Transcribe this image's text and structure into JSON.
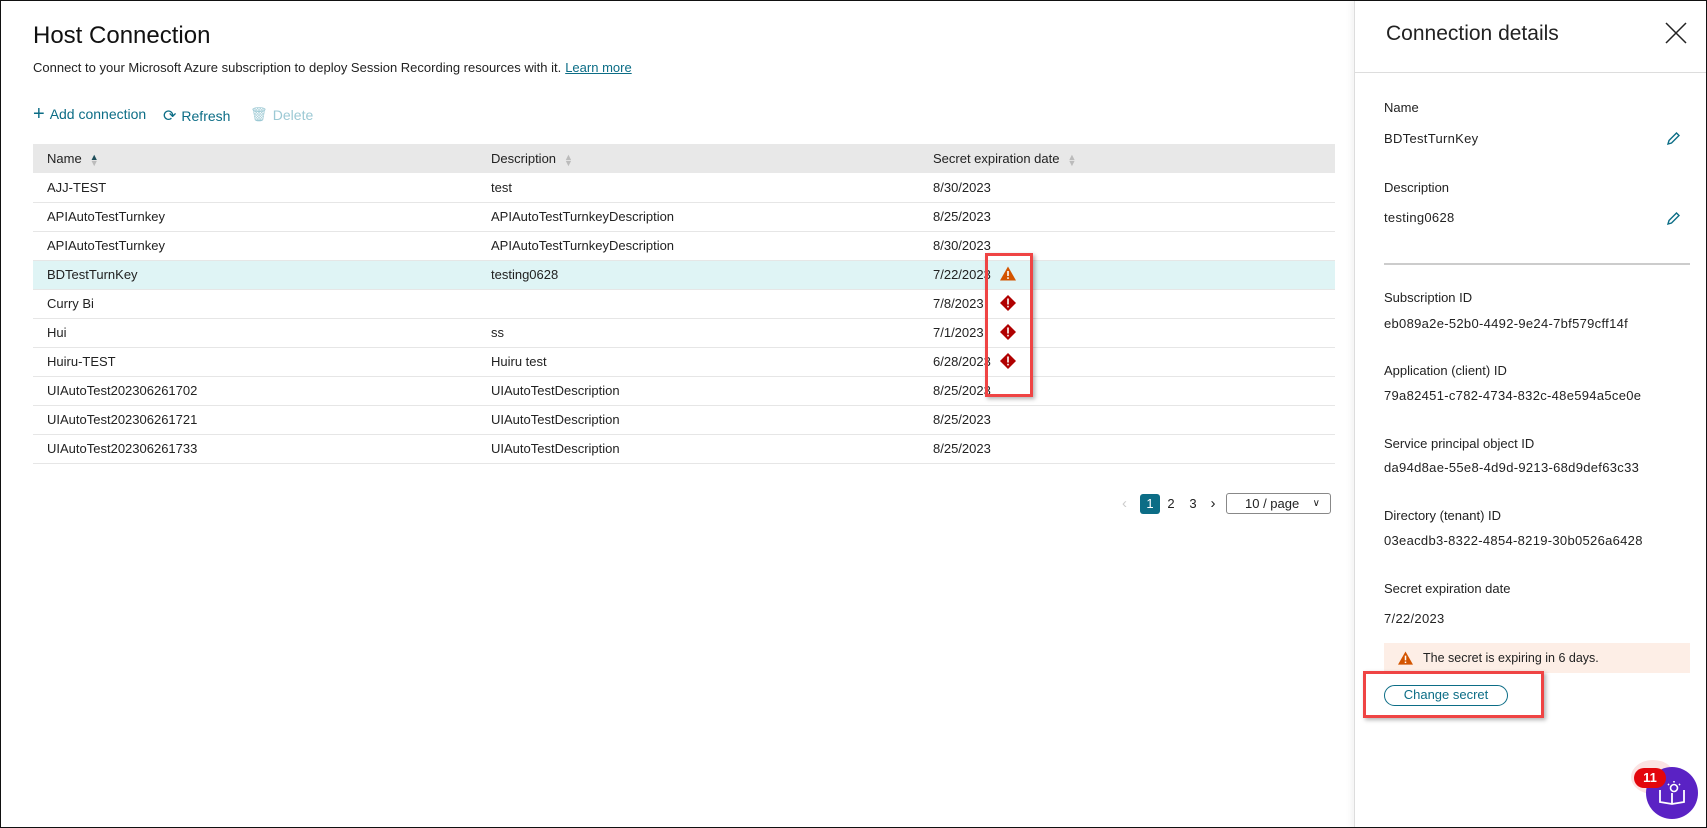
{
  "header": {
    "title": "Host Connection",
    "subtitle": "Connect to your Microsoft Azure subscription to deploy Session Recording resources with it.",
    "learn_more": "Learn more"
  },
  "toolbar": {
    "add": "Add connection",
    "refresh": "Refresh",
    "delete": "Delete"
  },
  "table": {
    "columns": [
      "Name",
      "Description",
      "Secret expiration date"
    ],
    "rows": [
      {
        "name": "AJJ-TEST",
        "description": "test",
        "expiry": "8/30/2023",
        "status": ""
      },
      {
        "name": "APIAutoTestTurnkey",
        "description": "APIAutoTestTurnkeyDescription",
        "expiry": "8/25/2023",
        "status": ""
      },
      {
        "name": "APIAutoTestTurnkey",
        "description": "APIAutoTestTurnkeyDescription",
        "expiry": "8/30/2023",
        "status": ""
      },
      {
        "name": "BDTestTurnKey",
        "description": "testing0628",
        "expiry": "7/22/2023",
        "status": "warning"
      },
      {
        "name": "Curry Bi",
        "description": "",
        "expiry": "7/8/2023",
        "status": "expired"
      },
      {
        "name": "Hui",
        "description": "ss",
        "expiry": "7/1/2023",
        "status": "expired"
      },
      {
        "name": "Huiru-TEST",
        "description": "Huiru test",
        "expiry": "6/28/2023",
        "status": "expired"
      },
      {
        "name": "UIAutoTest202306261702",
        "description": "UIAutoTestDescription",
        "expiry": "8/25/2023",
        "status": ""
      },
      {
        "name": "UIAutoTest202306261721",
        "description": "UIAutoTestDescription",
        "expiry": "8/25/2023",
        "status": ""
      },
      {
        "name": "UIAutoTest202306261733",
        "description": "UIAutoTestDescription",
        "expiry": "8/25/2023",
        "status": ""
      }
    ]
  },
  "pagination": {
    "pages": [
      "1",
      "2",
      "3"
    ],
    "current": "1",
    "page_size": "10 / page"
  },
  "panel": {
    "title": "Connection details",
    "name_label": "Name",
    "name_value": "BDTestTurnKey",
    "desc_label": "Description",
    "desc_value": "testing0628",
    "sub_label": "Subscription ID",
    "sub_value": "eb089a2e-52b0-4492-9e24-7bf579cff14f",
    "app_label": "Application (client) ID",
    "app_value": "79a82451-c782-4734-832c-48e594a5ce0e",
    "sp_label": "Service principal object ID",
    "sp_value": "da94d8ae-55e8-4d9d-9213-68d9def63c33",
    "dir_label": "Directory (tenant) ID",
    "dir_value": "03eacdb3-8322-4854-8219-30b0526a6428",
    "exp_label": "Secret expiration date",
    "exp_value": "7/22/2023",
    "warning": "The secret is expiring in 6 days.",
    "change_secret": "Change secret"
  },
  "help": {
    "badge": "11"
  },
  "colors": {
    "accent": "#0c6d86",
    "warning": "#d35400",
    "error": "#b00000",
    "help": "#5a22c4"
  }
}
